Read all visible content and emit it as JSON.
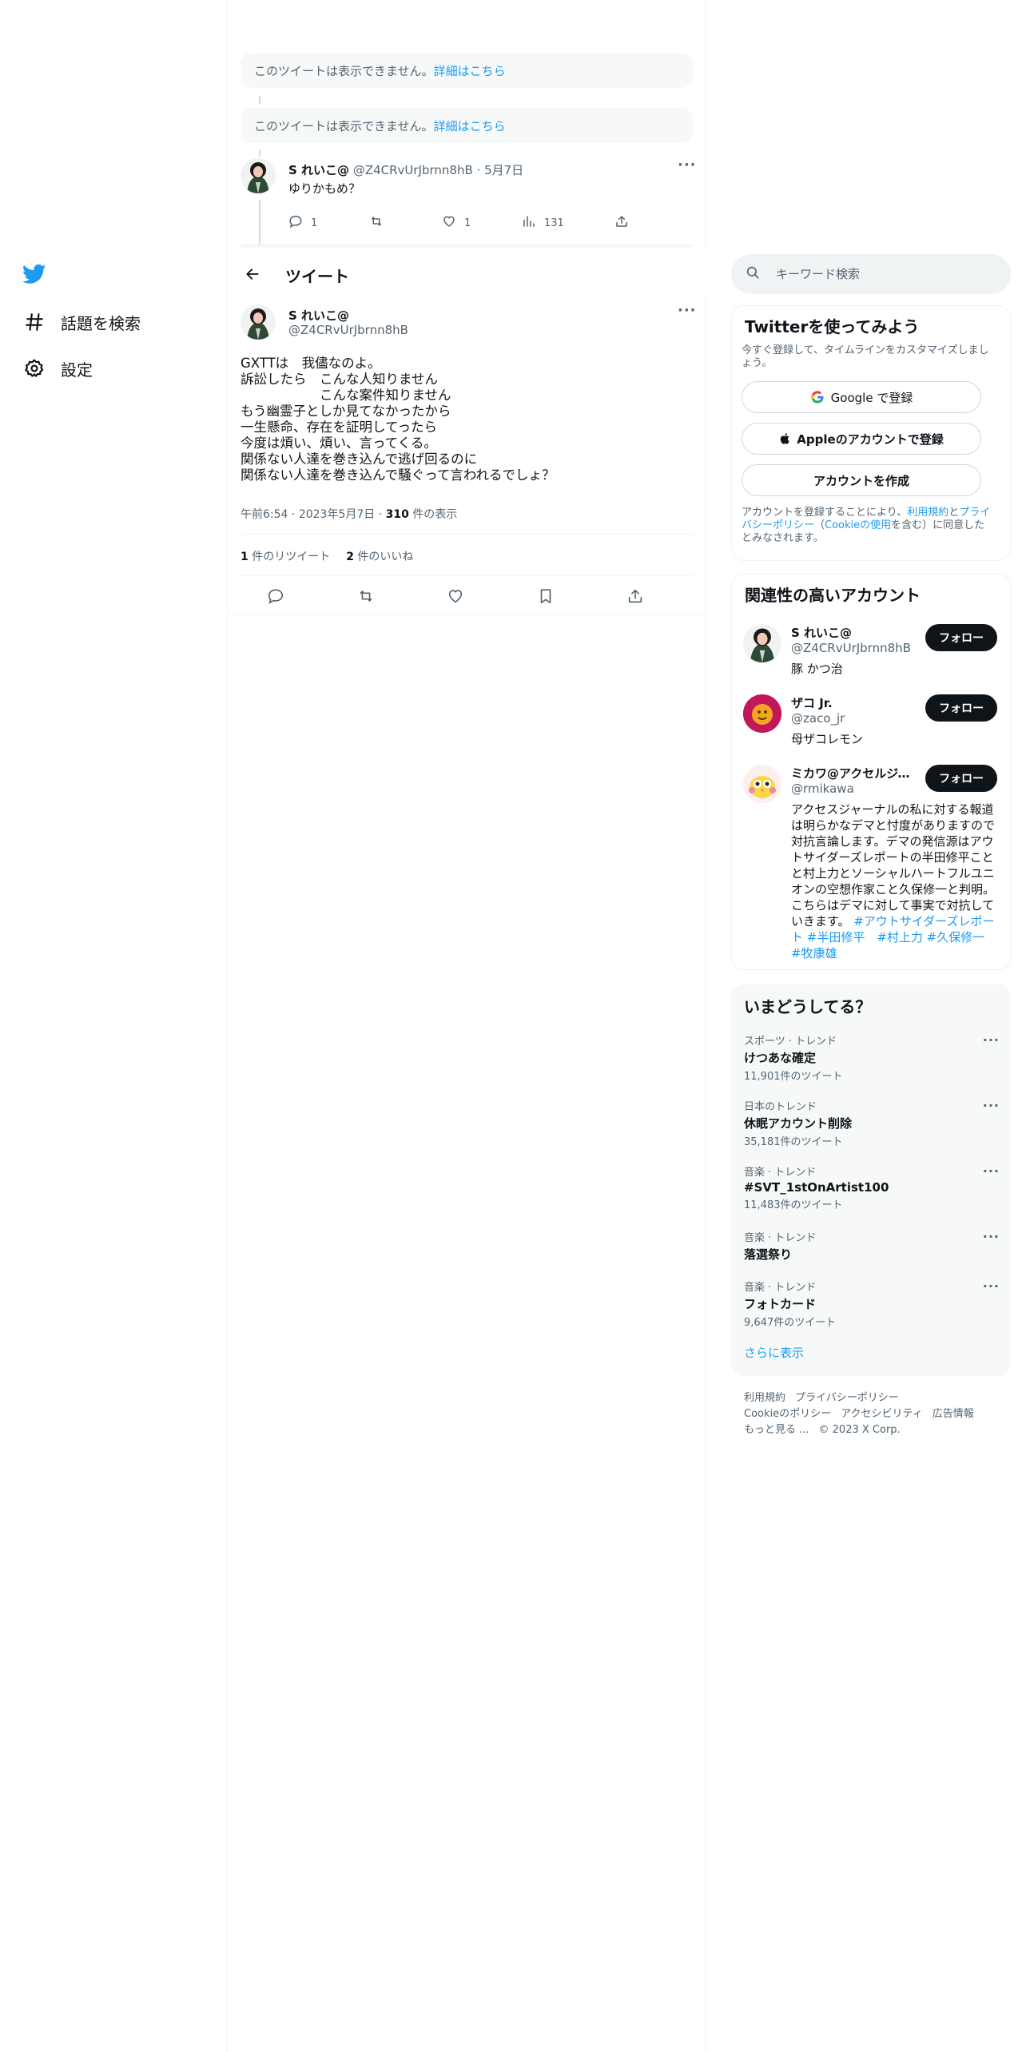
{
  "nav": {
    "explore_label": "話題を検索",
    "settings_label": "設定"
  },
  "thread": {
    "unavailable_text": "このツイートは表示できません。",
    "unavailable_link": "詳細はこちら",
    "reply": {
      "name": "S れいこ@",
      "handle": "@Z4CRvUrJbrnn8hB",
      "date": "5月7日",
      "text": "ゆりかもめ？",
      "reply_count": "1",
      "like_count": "1",
      "views": "131"
    }
  },
  "header": {
    "title": "ツイート"
  },
  "tweet": {
    "name": "S れいこ@",
    "handle": "@Z4CRvUrJbrnn8hB",
    "text": "GXTTは　我儘なのよ。\n訴訟したら　こんな人知りません\n　　　　　　こんな案件知りません\nもう幽霊子としか見てなかったから\n一生懸命、存在を証明してったら\n今度は煩い、煩い、言ってくる。\n関係ない人達を巻き込んで逃げ回るのに\n関係ない人達を巻き込んで騒ぐって言われるでしょ？",
    "time": "午前6:54",
    "date": "2023年5月7日",
    "views": "310",
    "views_label": "件の表示",
    "retweets": "1",
    "retweets_label": "件のリツイート",
    "likes": "2",
    "likes_label": "件のいいね"
  },
  "search": {
    "placeholder": "キーワード検索"
  },
  "signup": {
    "title": "Twitterを使ってみよう",
    "subtitle": "今すぐ登録して、タイムラインをカスタマイズしましょう。",
    "google_label": "Google で登録",
    "apple_label": "Appleのアカウントで登録",
    "create_label": "アカウントを作成",
    "legal_prefix": "アカウントを登録することにより、",
    "legal_terms": "利用規約",
    "legal_and": "と",
    "legal_privacy": "プライバシーポリシー",
    "legal_cookie_open": "（",
    "legal_cookie": "Cookieの使用",
    "legal_suffix": "を含む）に同意したとみなされます。"
  },
  "related": {
    "title": "関連性の高いアカウント",
    "follow_label": "フォロー",
    "accounts": [
      {
        "name": "S れいこ@",
        "handle": "@Z4CRvUrJbrnn8hB",
        "bio": "豚 かつ治"
      },
      {
        "name": "ザコ Jr.",
        "handle": "@zaco_jr",
        "bio": "母ザコレモン"
      },
      {
        "name": "ミカワ@アクセルジャーナル",
        "handle": "@rmikawa",
        "bio": "アクセスジャーナルの私に対する報道は明らかなデマと忖度がありますので対抗言論します。デマの発信源はアウトサイダーズレポートの半田修平ことと村上力とソーシャルハートフルユニオンの空想作家こと久保修一と判明。こちらはデマに対して事実で対抗していきます。",
        "tags": "#アウトサイダーズレポート #半田修平　#村上力 #久保修一　#牧康雄"
      }
    ]
  },
  "trends": {
    "title": "いまどうしてる？",
    "items": [
      {
        "category": "スポーツ · トレンド",
        "name": "けつあな確定",
        "count": "11,901件のツイート"
      },
      {
        "category": "日本のトレンド",
        "name": "休眠アカウント削除",
        "count": "35,181件のツイート"
      },
      {
        "category": "音楽 · トレンド",
        "name": "#SVT_1stOnArtist100",
        "count": "11,483件のツイート"
      },
      {
        "category": "音楽 · トレンド",
        "name": "落選祭り",
        "count": ""
      },
      {
        "category": "音楽 · トレンド",
        "name": "フォトカード",
        "count": "9,647件のツイート"
      }
    ],
    "show_more": "さらに表示"
  },
  "footer": {
    "terms": "利用規約",
    "privacy": "プライバシーポリシー",
    "cookie": "Cookieのポリシー",
    "accessibility": "アクセシビリティ",
    "ads": "広告情報",
    "more": "もっと見る ...",
    "copyright": "© 2023 X Corp."
  },
  "colors": {
    "accent": "#1d9bf0",
    "text": "#0f1419",
    "secondary": "#536471",
    "border": "#eff3f4"
  }
}
